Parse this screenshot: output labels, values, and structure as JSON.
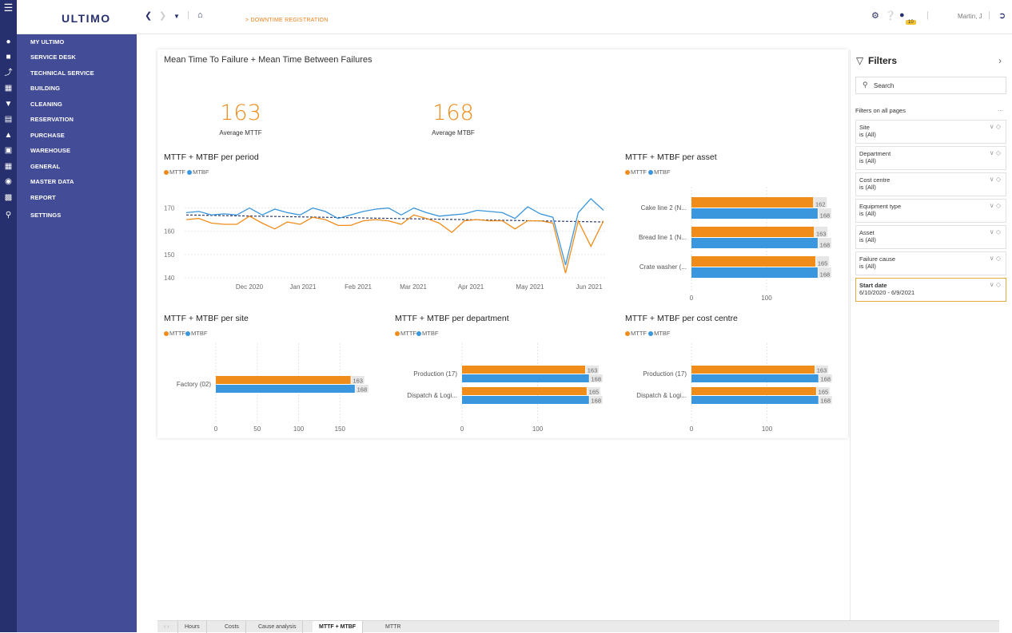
{
  "app": {
    "logo": "ULTIMO",
    "breadcrumb": "DOWNTIME REGISTRATION",
    "user": "Martin, J",
    "notification_count": "10"
  },
  "nav": {
    "items": [
      {
        "label": "MY ULTIMO",
        "icon": "user-icon"
      },
      {
        "label": "SERVICE DESK",
        "icon": "chat-icon"
      },
      {
        "label": "TECHNICAL SERVICE",
        "icon": "wrench-icon"
      },
      {
        "label": "BUILDING",
        "icon": "building-icon"
      },
      {
        "label": "CLEANING",
        "icon": "diamond-icon"
      },
      {
        "label": "RESERVATION",
        "icon": "calendar-icon"
      },
      {
        "label": "PURCHASE",
        "icon": "cart-icon"
      },
      {
        "label": "WAREHOUSE",
        "icon": "box-icon"
      },
      {
        "label": "GENERAL",
        "icon": "grid-icon"
      },
      {
        "label": "MASTER DATA",
        "icon": "database-icon"
      },
      {
        "label": "REPORT",
        "icon": "report-icon"
      },
      {
        "label": "SETTINGS",
        "icon": "key-icon"
      }
    ]
  },
  "report": {
    "title": "Mean Time To Failure + Mean Time Between Failures",
    "kpis": [
      {
        "value": "163",
        "label": "Average MTTF"
      },
      {
        "value": "168",
        "label": "Average MTBF"
      }
    ],
    "legend": {
      "mttf": "MTTF",
      "mtbf": "MTBF"
    },
    "colors": {
      "mttf": "#f08c1a",
      "mtbf": "#3a96dd"
    }
  },
  "chart_data": [
    {
      "type": "line",
      "title": "MTTF + MTBF per period",
      "x_tick_labels": [
        "Dec 2020",
        "Jan 2021",
        "Feb 2021",
        "Mar 2021",
        "Apr 2021",
        "May 2021",
        "Jun 2021"
      ],
      "ylim": [
        140,
        175
      ],
      "y_ticks": [
        "140",
        "150",
        "160",
        "170"
      ],
      "trendline": "MTBF dashed trend 167 to 164",
      "series": [
        {
          "name": "MTTF",
          "values": [
            165,
            165.5,
            163.5,
            163,
            163,
            166.5,
            163.5,
            161,
            164,
            163,
            166,
            165,
            162.5,
            162.5,
            164.5,
            165,
            164.5,
            163,
            167,
            165.5,
            163.5,
            159.5,
            164.5,
            165,
            164.5,
            164.5,
            161,
            164.5,
            164.5,
            163.5,
            142,
            164.5,
            153.5,
            164.5
          ]
        },
        {
          "name": "MTBF",
          "values": [
            168,
            168.5,
            167,
            167.5,
            167,
            170,
            167,
            169.5,
            168,
            167,
            170,
            168.5,
            165.5,
            167,
            168.5,
            169.5,
            170,
            167,
            170,
            168,
            166.5,
            167,
            167.5,
            169,
            168.5,
            168,
            165.5,
            170.5,
            167.5,
            166,
            145.5,
            168,
            174,
            169
          ]
        }
      ]
    },
    {
      "type": "bar",
      "title": "MTTF + MTBF per asset",
      "categories": [
        "Cake line 2 (N...",
        "Bread line 1 (N...",
        "Crate washer (..."
      ],
      "series": [
        {
          "name": "MTTF",
          "values": [
            162,
            163,
            165
          ]
        },
        {
          "name": "MTBF",
          "values": [
            168,
            168,
            168
          ]
        }
      ],
      "x_ticks": [
        "0",
        "100"
      ],
      "xmax": 200
    },
    {
      "type": "bar",
      "title": "MTTF + MTBF per site",
      "categories": [
        "Factory (02)"
      ],
      "series": [
        {
          "name": "MTTF",
          "values": [
            163
          ]
        },
        {
          "name": "MTBF",
          "values": [
            168
          ]
        }
      ],
      "x_ticks": [
        "0",
        "50",
        "100",
        "150"
      ],
      "xmax": 200
    },
    {
      "type": "bar",
      "title": "MTTF + MTBF per department",
      "categories": [
        "Production (17)",
        "Dispatch & Logi..."
      ],
      "series": [
        {
          "name": "MTTF",
          "values": [
            163,
            165
          ]
        },
        {
          "name": "MTBF",
          "values": [
            168,
            168
          ]
        }
      ],
      "x_ticks": [
        "0",
        "100"
      ],
      "xmax": 200
    },
    {
      "type": "bar",
      "title": "MTTF + MTBF per cost centre",
      "categories": [
        "Production (17)",
        "Dispatch & Logi..."
      ],
      "series": [
        {
          "name": "MTTF",
          "values": [
            163,
            165
          ]
        },
        {
          "name": "MTBF",
          "values": [
            168,
            168
          ]
        }
      ],
      "x_ticks": [
        "0",
        "100"
      ],
      "xmax": 200
    }
  ],
  "filters": {
    "title": "Filters",
    "search_placeholder": "Search",
    "section": "Filters on all pages",
    "more": "...",
    "items": [
      {
        "name": "Site",
        "value": "is (All)"
      },
      {
        "name": "Department",
        "value": "is (All)"
      },
      {
        "name": "Cost centre",
        "value": "is (All)"
      },
      {
        "name": "Equipment type",
        "value": "is (All)"
      },
      {
        "name": "Asset",
        "value": "is (All)"
      },
      {
        "name": "Failure cause",
        "value": "is (All)"
      },
      {
        "name": "Start date",
        "value": "6/10/2020 - 6/9/2021"
      }
    ]
  },
  "tabs": [
    "Hours",
    "Costs",
    "Cause analysis",
    "MTTF + MTBF",
    "MTTR"
  ],
  "active_tab": "MTTF + MTBF"
}
